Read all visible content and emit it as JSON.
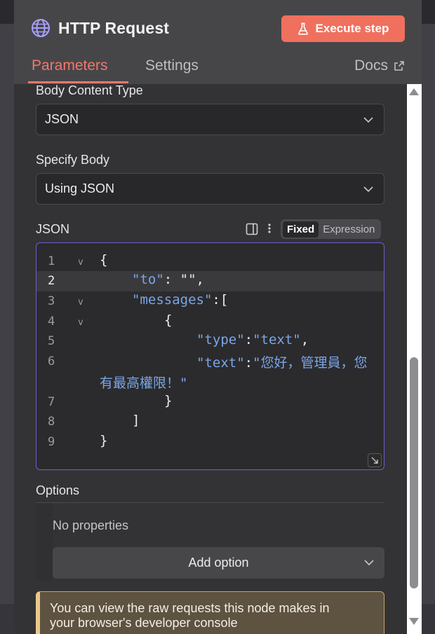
{
  "node": {
    "title": "HTTP Request",
    "execute_label": "Execute step"
  },
  "tabs": [
    {
      "label": "Parameters",
      "active": true
    },
    {
      "label": "Settings",
      "active": false
    }
  ],
  "docs_label": "Docs",
  "body_content_type": {
    "label": "Body Content Type",
    "value": "JSON"
  },
  "specify_body": {
    "label": "Specify Body",
    "value": "Using JSON"
  },
  "json_field": {
    "label": "JSON",
    "mode_fixed": "Fixed",
    "mode_expression": "Expression",
    "line_numbers": [
      "1",
      "2",
      "3",
      "4",
      "5",
      "6",
      "7",
      "8",
      "9"
    ],
    "current_line": "2",
    "code": {
      "l1": "{",
      "l2_key": "\"to\"",
      "l2_rest": ": \"\",",
      "l3_key": "\"messages\"",
      "l3_rest": ":[",
      "l4": "{",
      "l5_key": "\"type\"",
      "l5_colon": ":",
      "l5_val": "\"text\"",
      "l5_comma": ",",
      "l6_key": "\"text\"",
      "l6_colon": ":",
      "l6_val_a": "\"您好，管理員，您",
      "l6_val_b": "有最高權限！\"",
      "l7": "}",
      "l8": "]",
      "l9": "}"
    }
  },
  "options": {
    "label": "Options",
    "empty_text": "No properties",
    "add_label": "Add option"
  },
  "notice": {
    "line1": "You can view the raw requests this node makes in",
    "line2": "your browser's developer console"
  },
  "colors": {
    "accent": "#f0705e",
    "tab_active": "#f4766a",
    "editor_border": "#6a5fd0",
    "json_key": "#7aa6e8",
    "notice_bg": "#5e5240",
    "notice_border": "#e9c98a"
  },
  "icons": {
    "node": "globe-icon",
    "execute": "flask-icon",
    "docs": "external-link-icon",
    "select": "chevron-down-icon",
    "panel": "split-panel-icon",
    "more": "vertical-dots-icon",
    "resize": "resize-icon"
  }
}
